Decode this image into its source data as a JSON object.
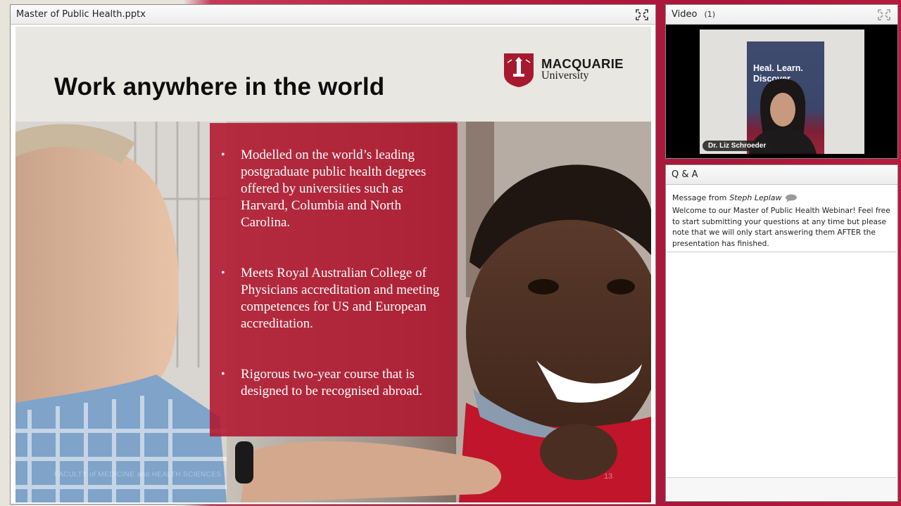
{
  "presentation": {
    "title": "Master of Public Health.pptx",
    "slide": {
      "heading": "Work anywhere in the world",
      "logo": {
        "name_line1": "MACQUARIE",
        "name_line2": "University"
      },
      "bullets": [
        {
          "text": "Modelled on the world’s leading postgraduate public health degrees offered by universities such as Harvard, Columbia and North Carolina."
        },
        {
          "text": "Meets Royal Australian College of Physicians accreditation and meeting competences for US and European accreditation."
        },
        {
          "text": "Rigorous two-year course that is designed to be recognised abroad."
        }
      ],
      "bullet_glyph": "•",
      "footer": "FACULTY of MEDICINE and HEALTH SCIENCES",
      "page_number": "13"
    }
  },
  "video": {
    "title": "Video",
    "count": "(1)",
    "presenter_name": "Dr. Liz Schroeder",
    "banner_text": "Heal. Learn. Discover."
  },
  "qa": {
    "title": "Q & A",
    "message_prefix": "Message from",
    "message_author": "Steph Leplaw",
    "message_body": "Welcome to our Master of Public Health Webinar! Feel free to start submitting your questions at any time but please note that we will only start answering them AFTER the presentation has finished."
  },
  "colors": {
    "accent_red": "#b0162d",
    "header_gradient": "#ececec"
  },
  "icons": {
    "expand": "expand-icon",
    "speech": "speech-bubble-icon"
  }
}
